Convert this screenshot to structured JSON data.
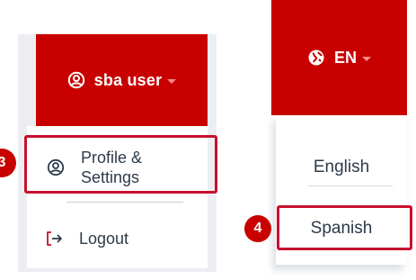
{
  "user_menu": {
    "toggle_label": "sba user",
    "items": [
      {
        "label": "Profile &\nSettings",
        "icon": "user-circle-icon"
      },
      {
        "label": "Logout",
        "icon": "logout-icon"
      }
    ]
  },
  "language_menu": {
    "toggle_label": "EN",
    "toggle_icon": "globe-icon",
    "options": [
      {
        "label": "English"
      },
      {
        "label": "Spanish"
      }
    ]
  },
  "annotations": {
    "step_profile": "3",
    "step_spanish": "4"
  },
  "colors": {
    "brand_red": "#c80000",
    "highlight_red": "#c8102e",
    "text": "#2e3a4a"
  }
}
